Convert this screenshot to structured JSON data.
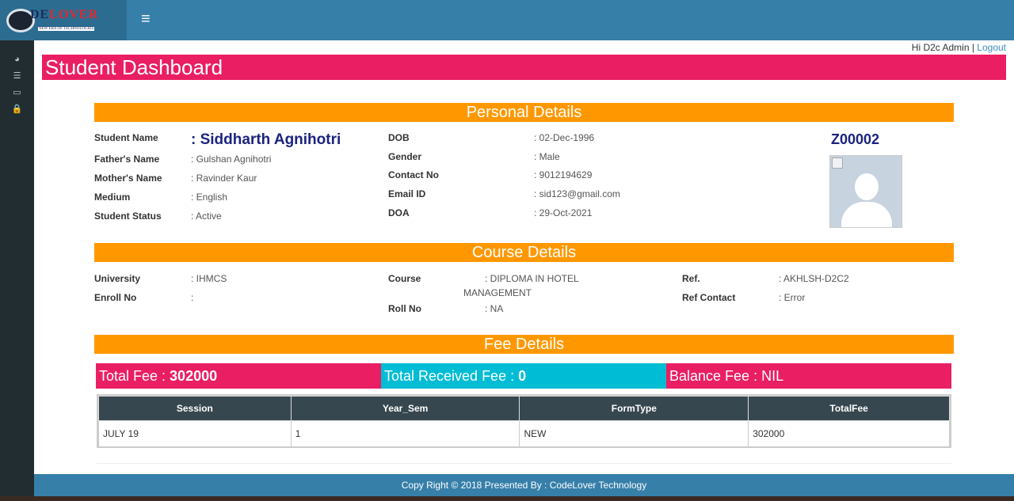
{
  "brand": {
    "logo_text_a": "DE",
    "logo_text_b": "LOVER",
    "logo_tagline": "NEW ERA OF TECHNOLOGIES"
  },
  "header": {
    "menu_icon": "hamburger-menu-icon"
  },
  "sidebar": {
    "items": [
      {
        "icon": "dashboard-icon",
        "glyph": "◕"
      },
      {
        "icon": "list-icon",
        "glyph": "☰"
      },
      {
        "icon": "folder-icon",
        "glyph": "▭"
      },
      {
        "icon": "lock-icon",
        "glyph": "🔒"
      }
    ]
  },
  "user": {
    "greeting": "Hi D2c Admin |",
    "logout_label": "Logout"
  },
  "page_title": "Student Dashboard",
  "personal": {
    "heading": "Personal Details",
    "student_name_label": "Student Name",
    "student_name": ": Siddharth Agnihotri",
    "father_label": "Father's Name",
    "father": ": Gulshan Agnihotri",
    "mother_label": "Mother's Name",
    "mother": ": Ravinder Kaur",
    "medium_label": "Medium",
    "medium": ": English",
    "status_label": "Student Status",
    "status": ": Active",
    "dob_label": "DOB",
    "dob": ": 02-Dec-1996",
    "gender_label": "Gender",
    "gender": ": Male",
    "contact_label": "Contact No",
    "contact": ": 9012194629",
    "email_label": "Email ID",
    "email": ": sid123@gmail.com",
    "doa_label": "DOA",
    "doa": ": 29-Oct-2021",
    "student_code": "Z00002"
  },
  "course": {
    "heading": "Course Details",
    "university_label": "University",
    "university": ": IHMCS",
    "enroll_label": "Enroll No",
    "enroll": ":",
    "course_label": "Course",
    "course_line1": ": DIPLOMA IN HOTEL",
    "course_line2": "MANAGEMENT",
    "roll_label": "Roll No",
    "roll": ": NA",
    "ref_label": "Ref.",
    "ref": ": AKHLSH-D2C2",
    "ref_contact_label": "Ref Contact",
    "ref_contact": ": Error"
  },
  "fee": {
    "heading": "Fee Details",
    "total_label": "Total Fee : ",
    "total_value": "302000",
    "received_label": "Total Received Fee : ",
    "received_value": "0",
    "balance_label": "Balance Fee : NIL",
    "columns": [
      "Session",
      "Year_Sem",
      "FormType",
      "TotalFee"
    ],
    "rows": [
      [
        "JULY 19",
        "1",
        "NEW",
        "302000"
      ]
    ]
  },
  "colors": {
    "header": "#367fa9",
    "title_bar": "#e91e63",
    "section_bar": "#ff9800",
    "received_box": "#00bcd4",
    "table_header": "#37474f"
  },
  "footer": {
    "text": "Copy Right © 2018 Presented By : CodeLover Technology"
  }
}
